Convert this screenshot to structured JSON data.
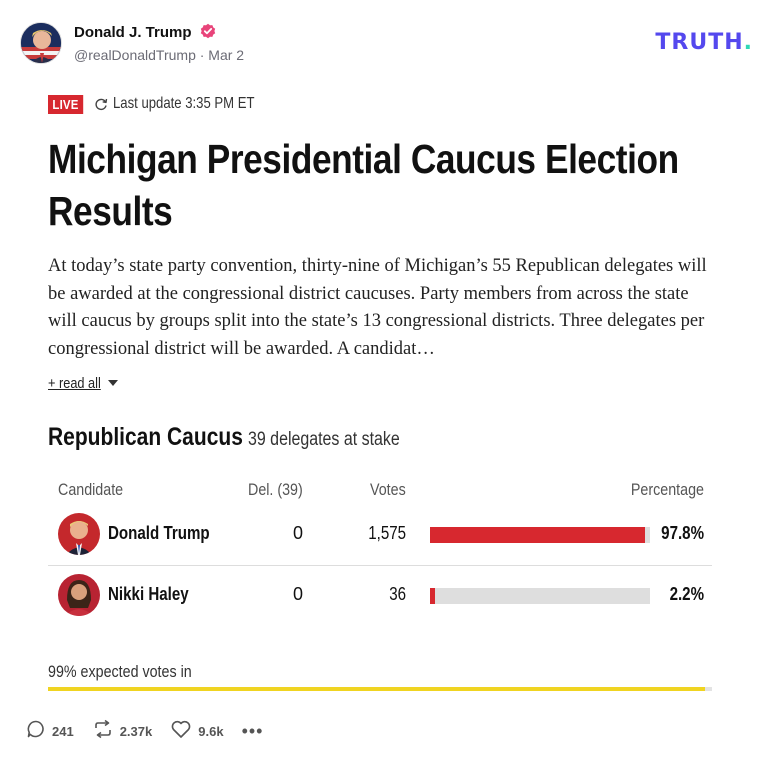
{
  "post": {
    "author_name": "Donald J. Trump",
    "handle_date": "@realDonaldTrump · Mar 2",
    "brand": "TRUTH",
    "brand_dot": "."
  },
  "article": {
    "live_label": "LIVE",
    "last_update": "Last update 3:35 PM ET",
    "headline": "Michigan Presidential Caucus Election Results",
    "intro": "At today’s state party convention, thirty-nine of Michigan’s 55 Republican delegates will be awarded at the congressional district caucuses. Party members from across the state will caucus by groups split into the state’s 13 congressional districts. Three delegates per congressional district will be awarded. A candidat…",
    "read_all": "+ read all"
  },
  "caucus": {
    "title": "Republican Caucus",
    "subtitle": "39 delegates at stake",
    "headers": {
      "candidate": "Candidate",
      "delegates": "Del. (39)",
      "votes": "Votes",
      "percentage": "Percentage"
    },
    "candidates": [
      {
        "name": "Donald Trump",
        "delegates": "0",
        "votes": "1,575",
        "percentage": "97.8%",
        "share": 0.978
      },
      {
        "name": "Nikki Haley",
        "delegates": "0",
        "votes": "36",
        "percentage": "2.2%",
        "share": 0.022
      }
    ],
    "expected_votes": "99% expected votes in",
    "expected_share": 0.99,
    "bar_color": "#d7282f",
    "expected_color": "#f0d421"
  },
  "actions": {
    "replies": "241",
    "retruths": "2.37k",
    "likes": "9.6k",
    "more": "•••"
  },
  "colors": {
    "brand": "#5448ee",
    "brand_dot": "#2fd8b5",
    "live": "#d7282f",
    "verified": "#e8447a"
  }
}
